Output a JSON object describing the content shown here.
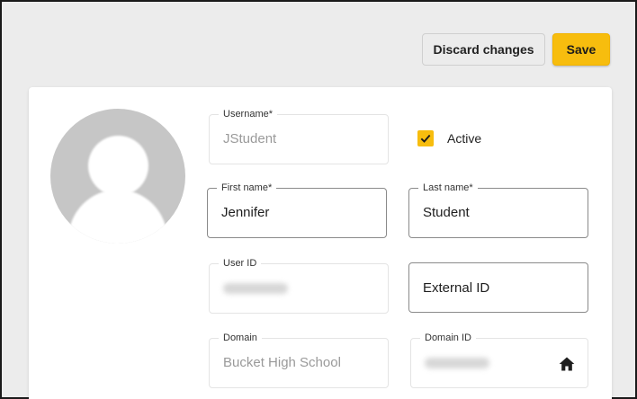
{
  "toolbar": {
    "discard_label": "Discard changes",
    "save_label": "Save",
    "save_color": "#f7bd0e"
  },
  "profile": {
    "avatar_icon": "default-user-avatar",
    "active": {
      "label": "Active",
      "checked": true
    },
    "fields": {
      "username": {
        "label": "Username*",
        "value": "JStudent",
        "disabled": true
      },
      "first_name": {
        "label": "First name*",
        "value": "Jennifer",
        "disabled": false
      },
      "last_name": {
        "label": "Last name*",
        "value": "Student",
        "disabled": false
      },
      "user_id": {
        "label": "User ID",
        "disabled": true,
        "value_redacted": true
      },
      "external_id": {
        "placeholder": "External ID",
        "disabled": false
      },
      "domain": {
        "label": "Domain",
        "value": "Bucket High School",
        "disabled": true
      },
      "domain_id": {
        "label": "Domain ID",
        "disabled": true,
        "value_redacted": true,
        "icon": "home-icon"
      }
    }
  }
}
